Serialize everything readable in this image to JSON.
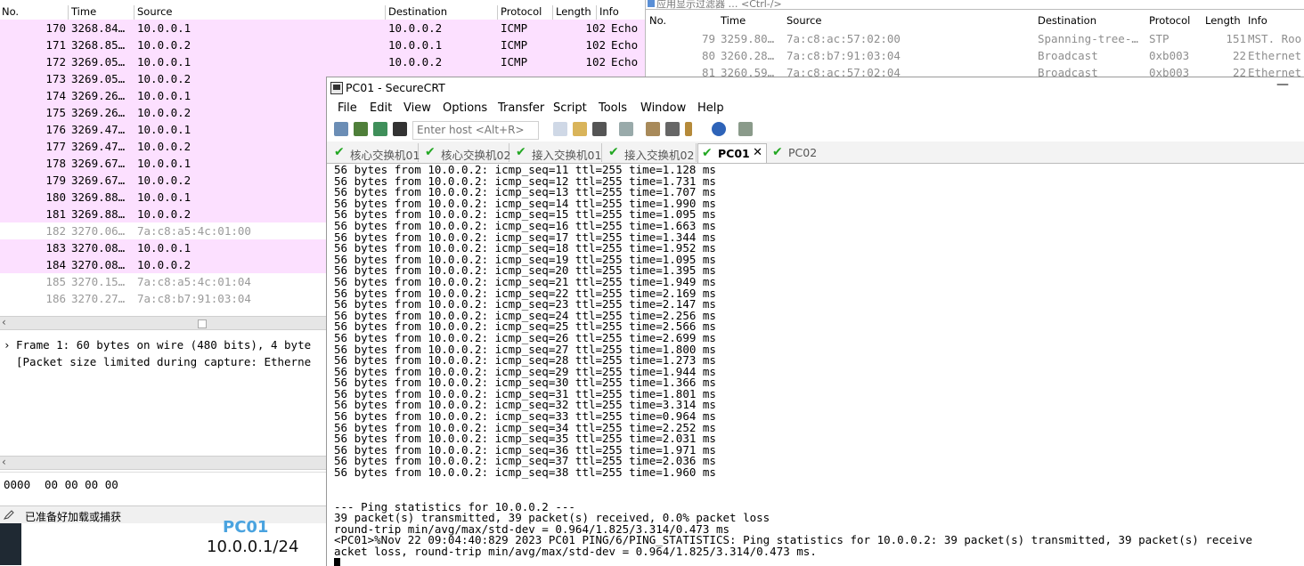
{
  "wireshark_left": {
    "columns": {
      "no": "No.",
      "time": "Time",
      "source": "Source",
      "destination": "Destination",
      "protocol": "Protocol",
      "length": "Length",
      "info": "Info"
    },
    "rows": [
      {
        "no": "170",
        "time": "3268.84…",
        "source": "10.0.0.1",
        "destination": "10.0.0.2",
        "protocol": "ICMP",
        "length": "102",
        "info": "Echo (p",
        "style": "icmp"
      },
      {
        "no": "171",
        "time": "3268.85…",
        "source": "10.0.0.2",
        "destination": "10.0.0.1",
        "protocol": "ICMP",
        "length": "102",
        "info": "Echo (p",
        "style": "icmp"
      },
      {
        "no": "172",
        "time": "3269.05…",
        "source": "10.0.0.1",
        "destination": "10.0.0.2",
        "protocol": "ICMP",
        "length": "102",
        "info": "Echo (p",
        "style": "icmp"
      },
      {
        "no": "173",
        "time": "3269.05…",
        "source": "10.0.0.2",
        "destination": "",
        "protocol": "",
        "length": "",
        "info": "",
        "style": "icmp"
      },
      {
        "no": "174",
        "time": "3269.26…",
        "source": "10.0.0.1",
        "destination": "",
        "protocol": "",
        "length": "",
        "info": "",
        "style": "icmp"
      },
      {
        "no": "175",
        "time": "3269.26…",
        "source": "10.0.0.2",
        "destination": "",
        "protocol": "",
        "length": "",
        "info": "",
        "style": "icmp"
      },
      {
        "no": "176",
        "time": "3269.47…",
        "source": "10.0.0.1",
        "destination": "",
        "protocol": "",
        "length": "",
        "info": "",
        "style": "icmp"
      },
      {
        "no": "177",
        "time": "3269.47…",
        "source": "10.0.0.2",
        "destination": "",
        "protocol": "",
        "length": "",
        "info": "",
        "style": "icmp"
      },
      {
        "no": "178",
        "time": "3269.67…",
        "source": "10.0.0.1",
        "destination": "",
        "protocol": "",
        "length": "",
        "info": "",
        "style": "icmp"
      },
      {
        "no": "179",
        "time": "3269.67…",
        "source": "10.0.0.2",
        "destination": "",
        "protocol": "",
        "length": "",
        "info": "",
        "style": "icmp"
      },
      {
        "no": "180",
        "time": "3269.88…",
        "source": "10.0.0.1",
        "destination": "",
        "protocol": "",
        "length": "",
        "info": "",
        "style": "icmp"
      },
      {
        "no": "181",
        "time": "3269.88…",
        "source": "10.0.0.2",
        "destination": "",
        "protocol": "",
        "length": "",
        "info": "",
        "style": "icmp"
      },
      {
        "no": "182",
        "time": "3270.06…",
        "source": "7a:c8:a5:4c:01:00",
        "destination": "",
        "protocol": "",
        "length": "",
        "info": "",
        "style": "grey"
      },
      {
        "no": "183",
        "time": "3270.08…",
        "source": "10.0.0.1",
        "destination": "",
        "protocol": "",
        "length": "",
        "info": "",
        "style": "icmp"
      },
      {
        "no": "184",
        "time": "3270.08…",
        "source": "10.0.0.2",
        "destination": "",
        "protocol": "",
        "length": "",
        "info": "",
        "style": "icmp"
      },
      {
        "no": "185",
        "time": "3270.15…",
        "source": "7a:c8:a5:4c:01:04",
        "destination": "",
        "protocol": "",
        "length": "",
        "info": "",
        "style": "grey"
      },
      {
        "no": "186",
        "time": "3270.27…",
        "source": "7a:c8:b7:91:03:04",
        "destination": "",
        "protocol": "",
        "length": "",
        "info": "",
        "style": "grey"
      }
    ],
    "detail_lines": [
      "Frame 1: 60 bytes on wire (480 bits), 4 byte",
      "[Packet size limited during capture: Etherne"
    ],
    "bytes_offset": "0000",
    "bytes_hex": "00 00 00 00",
    "status_text": "已准备好加载或捕获",
    "topology_pc_name": "PC01",
    "topology_ip": "10.0.0.1/24"
  },
  "wireshark_right": {
    "filter_placeholder": "应用显示过滤器 … <Ctrl-/>",
    "columns": {
      "no": "No.",
      "time": "Time",
      "source": "Source",
      "destination": "Destination",
      "protocol": "Protocol",
      "length": "Length",
      "info": "Info"
    },
    "rows": [
      {
        "no": "79",
        "time": "3259.80…",
        "source": "7a:c8:ac:57:02:00",
        "destination": "Spanning-tree-…",
        "protocol": "STP",
        "length": "151",
        "info": "MST. Roo"
      },
      {
        "no": "80",
        "time": "3260.28…",
        "source": "7a:c8:b7:91:03:04",
        "destination": "Broadcast",
        "protocol": "0xb003",
        "length": "22",
        "info": "Ethernet"
      },
      {
        "no": "81",
        "time": "3260.59…",
        "source": "7a:c8:ac:57:02:04",
        "destination": "Broadcast",
        "protocol": "0xb003",
        "length": "22",
        "info": "Ethernet"
      }
    ]
  },
  "securecrt": {
    "title": "PC01 - SecureCRT",
    "menu": [
      "File",
      "Edit",
      "View",
      "Options",
      "Transfer",
      "Script",
      "Tools",
      "Window",
      "Help"
    ],
    "host_placeholder": "Enter host <Alt+R>",
    "tabs": [
      {
        "label": "核心交换机01",
        "active": false
      },
      {
        "label": "核心交换机02",
        "active": false
      },
      {
        "label": "接入交换机01",
        "active": false
      },
      {
        "label": "接入交换机02",
        "active": false
      },
      {
        "label": "PC01",
        "active": true
      },
      {
        "label": "PC02",
        "active": false
      }
    ],
    "ping_lines": [
      "56 bytes from 10.0.0.2: icmp_seq=11 ttl=255 time=1.128 ms",
      "56 bytes from 10.0.0.2: icmp_seq=12 ttl=255 time=1.731 ms",
      "56 bytes from 10.0.0.2: icmp_seq=13 ttl=255 time=1.707 ms",
      "56 bytes from 10.0.0.2: icmp_seq=14 ttl=255 time=1.990 ms",
      "56 bytes from 10.0.0.2: icmp_seq=15 ttl=255 time=1.095 ms",
      "56 bytes from 10.0.0.2: icmp_seq=16 ttl=255 time=1.663 ms",
      "56 bytes from 10.0.0.2: icmp_seq=17 ttl=255 time=1.344 ms",
      "56 bytes from 10.0.0.2: icmp_seq=18 ttl=255 time=1.952 ms",
      "56 bytes from 10.0.0.2: icmp_seq=19 ttl=255 time=1.095 ms",
      "56 bytes from 10.0.0.2: icmp_seq=20 ttl=255 time=1.395 ms",
      "56 bytes from 10.0.0.2: icmp_seq=21 ttl=255 time=1.949 ms",
      "56 bytes from 10.0.0.2: icmp_seq=22 ttl=255 time=2.169 ms",
      "56 bytes from 10.0.0.2: icmp_seq=23 ttl=255 time=2.147 ms",
      "56 bytes from 10.0.0.2: icmp_seq=24 ttl=255 time=2.256 ms",
      "56 bytes from 10.0.0.2: icmp_seq=25 ttl=255 time=2.566 ms",
      "56 bytes from 10.0.0.2: icmp_seq=26 ttl=255 time=2.699 ms",
      "56 bytes from 10.0.0.2: icmp_seq=27 ttl=255 time=1.800 ms",
      "56 bytes from 10.0.0.2: icmp_seq=28 ttl=255 time=1.273 ms",
      "56 bytes from 10.0.0.2: icmp_seq=29 ttl=255 time=1.944 ms",
      "56 bytes from 10.0.0.2: icmp_seq=30 ttl=255 time=1.366 ms",
      "56 bytes from 10.0.0.2: icmp_seq=31 ttl=255 time=1.801 ms",
      "56 bytes from 10.0.0.2: icmp_seq=32 ttl=255 time=3.314 ms",
      "56 bytes from 10.0.0.2: icmp_seq=33 ttl=255 time=0.964 ms",
      "56 bytes from 10.0.0.2: icmp_seq=34 ttl=255 time=2.252 ms",
      "56 bytes from 10.0.0.2: icmp_seq=35 ttl=255 time=2.031 ms",
      "56 bytes from 10.0.0.2: icmp_seq=36 ttl=255 time=1.971 ms",
      "56 bytes from 10.0.0.2: icmp_seq=37 ttl=255 time=2.036 ms",
      "56 bytes from 10.0.0.2: icmp_seq=38 ttl=255 time=1.960 ms"
    ],
    "stats_lines": [
      "",
      "--- Ping statistics for 10.0.0.2 ---",
      "39 packet(s) transmitted, 39 packet(s) received, 0.0% packet loss",
      "round-trip min/avg/max/std-dev = 0.964/1.825/3.314/0.473 ms",
      "<PC01>%Nov 22 09:04:40:829 2023 PC01 PING/6/PING_STATISTICS: Ping statistics for 10.0.0.2: 39 packet(s) transmitted, 39 packet(s) receive",
      "acket loss, round-trip min/avg/max/std-dev = 0.964/1.825/3.314/0.473 ms."
    ]
  },
  "colors": {
    "icmp_row": "#fce0ff",
    "tab_check": "#22a722",
    "pc_label": "#4aa3df"
  }
}
